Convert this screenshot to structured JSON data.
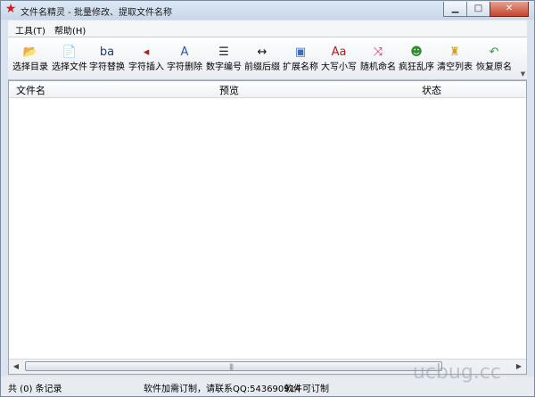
{
  "window": {
    "title": "文件名精灵 - 批量修改、提取文件名称",
    "controls": {
      "minimize": "▁",
      "maximize": "□",
      "close": "✕"
    }
  },
  "menu": [
    {
      "label": "工具(T)"
    },
    {
      "label": "帮助(H)"
    }
  ],
  "toolbar": [
    {
      "label": "选择目录",
      "icon": "folder-open-icon",
      "glyph": "📂",
      "color": "#d4a017"
    },
    {
      "label": "选择文件",
      "icon": "file-icon",
      "glyph": "📄",
      "color": "#c79a2a"
    },
    {
      "label": "字符替换",
      "icon": "replace-chars-icon",
      "glyph": "ba",
      "color": "#1f3a7a"
    },
    {
      "label": "字符插入",
      "icon": "insert-chars-icon",
      "glyph": "◂",
      "color": "#9b2b2b"
    },
    {
      "label": "字符删除",
      "icon": "delete-chars-icon",
      "glyph": "A",
      "color": "#2b55b5"
    },
    {
      "label": "数字编号",
      "icon": "numbered-list-icon",
      "glyph": "☰",
      "color": "#222222"
    },
    {
      "label": "前缀后缀",
      "icon": "prefix-suffix-icon",
      "glyph": "↔",
      "color": "#111111"
    },
    {
      "label": "扩展名称",
      "icon": "extension-icon",
      "glyph": "▣",
      "color": "#3a6fbf"
    },
    {
      "label": "大写小写",
      "icon": "case-icon",
      "glyph": "Aa",
      "color": "#b3201d"
    },
    {
      "label": "随机命名",
      "icon": "shuffle-icon",
      "glyph": "⤨",
      "color": "#d81b60"
    },
    {
      "label": "疯狂乱序",
      "icon": "crazy-shuffle-icon",
      "glyph": "☻",
      "color": "#2e8b2e"
    },
    {
      "label": "清空列表",
      "icon": "clear-list-icon",
      "glyph": "♜",
      "color": "#e0a000"
    },
    {
      "label": "恢复原名",
      "icon": "restore-icon",
      "glyph": "↶",
      "color": "#2e9b3a"
    }
  ],
  "list": {
    "columns": [
      {
        "label": "文件名"
      },
      {
        "label": "预览"
      },
      {
        "label": "状态"
      }
    ],
    "scroll_grip": "|||"
  },
  "status": {
    "count": "共 (0) 条记录",
    "contact": "软件加需订制，请联系QQ:543690914",
    "custom": "软件可订制"
  },
  "watermark": "ucbug.cc"
}
